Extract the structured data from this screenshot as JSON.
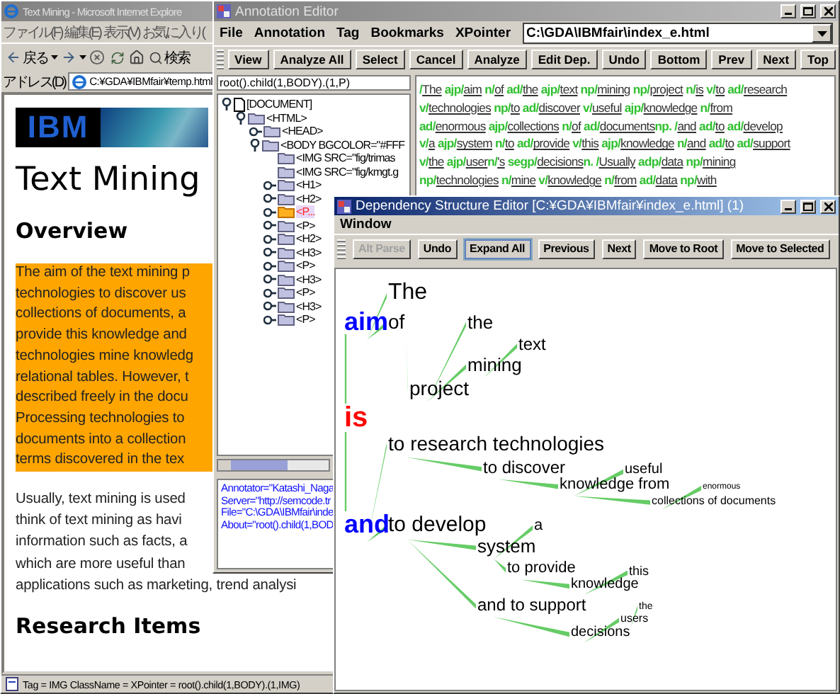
{
  "browser": {
    "title": "Text Mining - Microsoft Internet Explore",
    "active": false,
    "menus": [
      "ファイル(F)",
      "編集(E)",
      "表示(V)",
      "お気に入り("
    ],
    "toolbar": {
      "back_label": "戻る",
      "search_label": "検索"
    },
    "address": {
      "label": "アドレス(D)",
      "value": "C:¥GDA¥IBMfair¥temp.html"
    },
    "page": {
      "logo": "IBM",
      "blocks": [
        {
          "kind": "h1",
          "text": "Text Mining"
        },
        {
          "kind": "h2",
          "text": "Overview"
        },
        {
          "kind": "paragraph",
          "highlighted": true,
          "lines": [
            "The aim of the text mining p",
            "technologies to discover us",
            "collections of documents, a",
            "provide this knowledge and",
            "technologies mine knowledg",
            "relational tables. However, t",
            "described freely in the docu",
            "Processing technologies to",
            "documents into a collection",
            "terms discovered in the tex"
          ]
        },
        {
          "kind": "paragraph",
          "highlighted": false,
          "lines": [
            "Usually, text mining is used",
            "think of text mining as havi",
            "information such as facts, a",
            "which are more useful than",
            "applications such as marketing, trend analysi"
          ]
        },
        {
          "kind": "h2",
          "text": "Research Items"
        }
      ]
    },
    "status": "Tag = IMG ClassName =  XPointer = root().child(1,BODY).(1,IMG)"
  },
  "annotation_editor": {
    "title": "Annotation Editor",
    "active": false,
    "menus": [
      "File",
      "Annotation",
      "Tag",
      "Bookmarks",
      "XPointer"
    ],
    "path": "C:\\GDA\\IBMfair\\index_e.html",
    "buttons": [
      "View",
      "Analyze All",
      "Select",
      "Cancel",
      "Analyze",
      "Edit Dep.",
      "Undo",
      "Bottom",
      "Prev",
      "Next",
      "Top"
    ],
    "xpointer": "root().child(1,BODY).(1,P)",
    "tree": [
      {
        "label": "[DOCUMENT]",
        "kind": "document",
        "expanded": true,
        "selected": false,
        "children": [
          {
            "label": "<HTML>",
            "kind": "element",
            "expanded": true,
            "selected": false,
            "children": [
              {
                "label": "<HEAD>",
                "kind": "element",
                "expanded": false,
                "selected": false
              },
              {
                "label": "<BODY BGCOLOR=\"#FFF",
                "kind": "element",
                "expanded": true,
                "selected": false,
                "children": [
                  {
                    "label": "<IMG SRC=\"fig/trimas",
                    "kind": "element",
                    "selected": false
                  },
                  {
                    "label": "<IMG SRC=\"fig/kmgt.g",
                    "kind": "element",
                    "selected": false
                  },
                  {
                    "label": "<H1>",
                    "kind": "element",
                    "expanded": false,
                    "selected": false
                  },
                  {
                    "label": "<H2>",
                    "kind": "element",
                    "expanded": false,
                    "selected": false
                  },
                  {
                    "label": "<P...",
                    "kind": "element",
                    "expanded": false,
                    "selected": true
                  },
                  {
                    "label": "<P>",
                    "kind": "element",
                    "expanded": false,
                    "selected": false
                  },
                  {
                    "label": "<H2>",
                    "kind": "element",
                    "expanded": false,
                    "selected": false
                  },
                  {
                    "label": "<H3>",
                    "kind": "element",
                    "expanded": false,
                    "selected": false
                  },
                  {
                    "label": "<P>",
                    "kind": "element",
                    "expanded": false,
                    "selected": false
                  },
                  {
                    "label": "<H3>",
                    "kind": "element",
                    "expanded": false,
                    "selected": false
                  },
                  {
                    "label": "<P>",
                    "kind": "element",
                    "expanded": false,
                    "selected": false
                  },
                  {
                    "label": "<H3>",
                    "kind": "element",
                    "expanded": false,
                    "selected": false
                  },
                  {
                    "label": "<P>",
                    "kind": "element",
                    "expanded": false,
                    "selected": false
                  }
                ]
              }
            ]
          }
        ]
      }
    ],
    "properties": [
      "Annotator=\"Katashi_Naga",
      "Server=\"http://semcode.tr",
      "File=\"C:\\GDA\\IBMfair\\inde",
      "About=\"root().child(1,BOD"
    ],
    "annotated_lines": [
      [
        {
          "kind": "tag",
          "text": "/"
        },
        {
          "kind": "word",
          "text": "The"
        },
        {
          "kind": "tag",
          "text": " ajp/"
        },
        {
          "kind": "word",
          "text": "aim"
        },
        {
          "kind": "tag",
          "text": " n/"
        },
        {
          "kind": "word",
          "text": "of"
        },
        {
          "kind": "tag",
          "text": " ad/"
        },
        {
          "kind": "word",
          "text": "the"
        },
        {
          "kind": "tag",
          "text": " ajp/"
        },
        {
          "kind": "word",
          "text": "text"
        },
        {
          "kind": "tag",
          "text": " np/"
        },
        {
          "kind": "word",
          "text": "mining"
        },
        {
          "kind": "tag",
          "text": " np/"
        },
        {
          "kind": "word",
          "text": "project"
        },
        {
          "kind": "tag",
          "text": " n/"
        },
        {
          "kind": "word",
          "text": "is"
        },
        {
          "kind": "tag",
          "text": " v/"
        },
        {
          "kind": "word",
          "text": "to"
        },
        {
          "kind": "tag",
          "text": " ad/"
        },
        {
          "kind": "word",
          "text": "research"
        }
      ],
      [
        {
          "kind": "tag",
          "text": "v/"
        },
        {
          "kind": "word",
          "text": "technologies"
        },
        {
          "kind": "tag",
          "text": " np/"
        },
        {
          "kind": "word",
          "text": "to"
        },
        {
          "kind": "tag",
          "text": " ad/"
        },
        {
          "kind": "word",
          "text": "discover"
        },
        {
          "kind": "tag",
          "text": " v/"
        },
        {
          "kind": "word",
          "text": "useful"
        },
        {
          "kind": "tag",
          "text": " ajp/"
        },
        {
          "kind": "word",
          "text": "knowledge"
        },
        {
          "kind": "tag",
          "text": " n/"
        },
        {
          "kind": "word",
          "text": "from"
        }
      ],
      [
        {
          "kind": "tag",
          "text": "ad/"
        },
        {
          "kind": "word",
          "text": "enormous"
        },
        {
          "kind": "tag",
          "text": " ajp/"
        },
        {
          "kind": "word",
          "text": "collections"
        },
        {
          "kind": "tag",
          "text": " n/"
        },
        {
          "kind": "word",
          "text": "of"
        },
        {
          "kind": "tag",
          "text": " ad/"
        },
        {
          "kind": "word",
          "text": "documents"
        },
        {
          "kind": "tag",
          "text": "np. /"
        },
        {
          "kind": "word",
          "text": "and"
        },
        {
          "kind": "tag",
          "text": " ad/"
        },
        {
          "kind": "word",
          "text": "to"
        },
        {
          "kind": "tag",
          "text": " ad/"
        },
        {
          "kind": "word",
          "text": "develop"
        }
      ],
      [
        {
          "kind": "tag",
          "text": "v/"
        },
        {
          "kind": "word",
          "text": "a"
        },
        {
          "kind": "tag",
          "text": " ajp/"
        },
        {
          "kind": "word",
          "text": "system"
        },
        {
          "kind": "tag",
          "text": " n/"
        },
        {
          "kind": "word",
          "text": "to"
        },
        {
          "kind": "tag",
          "text": " ad/"
        },
        {
          "kind": "word",
          "text": "provide"
        },
        {
          "kind": "tag",
          "text": " v/"
        },
        {
          "kind": "word",
          "text": "this"
        },
        {
          "kind": "tag",
          "text": " ajp/"
        },
        {
          "kind": "word",
          "text": "knowledge"
        },
        {
          "kind": "tag",
          "text": " n/"
        },
        {
          "kind": "word",
          "text": "and"
        },
        {
          "kind": "tag",
          "text": " ad/"
        },
        {
          "kind": "word",
          "text": "to"
        },
        {
          "kind": "tag",
          "text": " ad/"
        },
        {
          "kind": "word",
          "text": "support"
        }
      ],
      [
        {
          "kind": "tag",
          "text": "v/"
        },
        {
          "kind": "word",
          "text": "the"
        },
        {
          "kind": "tag",
          "text": " ajp/"
        },
        {
          "kind": "word",
          "text": "user"
        },
        {
          "kind": "tag",
          "text": "n/"
        },
        {
          "kind": "word",
          "text": "'s"
        },
        {
          "kind": "tag",
          "text": " segp/"
        },
        {
          "kind": "word",
          "text": "decisions"
        },
        {
          "kind": "tag",
          "text": "n. /"
        },
        {
          "kind": "word",
          "text": "Usually"
        },
        {
          "kind": "tag",
          "text": " adp/"
        },
        {
          "kind": "word",
          "text": "data"
        },
        {
          "kind": "tag",
          "text": " np/"
        },
        {
          "kind": "word",
          "text": "mining"
        }
      ],
      [
        {
          "kind": "tag",
          "text": "np/"
        },
        {
          "kind": "word",
          "text": "technologies"
        },
        {
          "kind": "tag",
          "text": " n/"
        },
        {
          "kind": "word",
          "text": "mine"
        },
        {
          "kind": "tag",
          "text": " v/"
        },
        {
          "kind": "word",
          "text": "knowledge"
        },
        {
          "kind": "tag",
          "text": " n/"
        },
        {
          "kind": "word",
          "text": "from"
        },
        {
          "kind": "tag",
          "text": " ad/"
        },
        {
          "kind": "word",
          "text": "data"
        },
        {
          "kind": "tag",
          "text": " np/"
        },
        {
          "kind": "word",
          "text": "with"
        }
      ]
    ]
  },
  "dependency_editor": {
    "title": "Dependency Structure Editor [C:¥GDA¥IBMfair¥index_e.html] (1)",
    "active": true,
    "menus": [
      "Window"
    ],
    "buttons": [
      {
        "label": "Alt Parse",
        "disabled": true,
        "focused": false
      },
      {
        "label": "Undo",
        "disabled": false,
        "focused": false
      },
      {
        "label": "Expand All",
        "disabled": false,
        "focused": true
      },
      {
        "label": "Previous",
        "disabled": false,
        "focused": false
      },
      {
        "label": "Next",
        "disabled": false,
        "focused": false
      },
      {
        "label": "Move to Root",
        "disabled": false,
        "focused": false
      },
      {
        "label": "Move to Selected",
        "disabled": false,
        "focused": false
      }
    ],
    "tree": {
      "word": "is",
      "color": "#ff0000",
      "children": [
        {
          "word": "aim",
          "color": "#0000ff",
          "children": [
            {
              "word": "The",
              "color": "#000000"
            },
            {
              "word": "of",
              "color": "#000000",
              "children": [
                {
                  "word": "project",
                  "color": "#000000",
                  "children": [
                    {
                      "word": "the",
                      "color": "#000000"
                    },
                    {
                      "word": "mining",
                      "color": "#000000",
                      "children": [
                        {
                          "word": "text",
                          "color": "#000000"
                        }
                      ]
                    }
                  ]
                }
              ]
            }
          ]
        },
        {
          "word": "and",
          "color": "#0000ff",
          "children": [
            {
              "word": "to research technologies",
              "color": "#000000",
              "children": [
                {
                  "word": "to discover",
                  "color": "#000000",
                  "children": [
                    {
                      "word": "knowledge from",
                      "color": "#000000",
                      "children": [
                        {
                          "word": "useful",
                          "color": "#000000"
                        },
                        {
                          "word": "collections of documents",
                          "color": "#000000",
                          "children": [
                            {
                              "word": "enormous",
                              "color": "#000000"
                            }
                          ]
                        }
                      ]
                    }
                  ]
                }
              ]
            },
            {
              "word": "to develop",
              "color": "#000000",
              "children": [
                {
                  "word": "system",
                  "color": "#000000",
                  "children": [
                    {
                      "word": "a",
                      "color": "#000000"
                    },
                    {
                      "word": "to provide",
                      "color": "#000000",
                      "children": [
                        {
                          "word": "knowledge",
                          "color": "#000000",
                          "children": [
                            {
                              "word": "this",
                              "color": "#000000"
                            }
                          ]
                        }
                      ]
                    }
                  ]
                },
                {
                  "word": "and to support",
                  "color": "#000000",
                  "children": [
                    {
                      "word": "decisions",
                      "color": "#000000",
                      "children": [
                        {
                          "word": "users",
                          "color": "#000000",
                          "children": [
                            {
                              "word": "the",
                              "color": "#000000"
                            }
                          ]
                        }
                      ]
                    }
                  ]
                }
              ]
            }
          ]
        }
      ]
    }
  }
}
